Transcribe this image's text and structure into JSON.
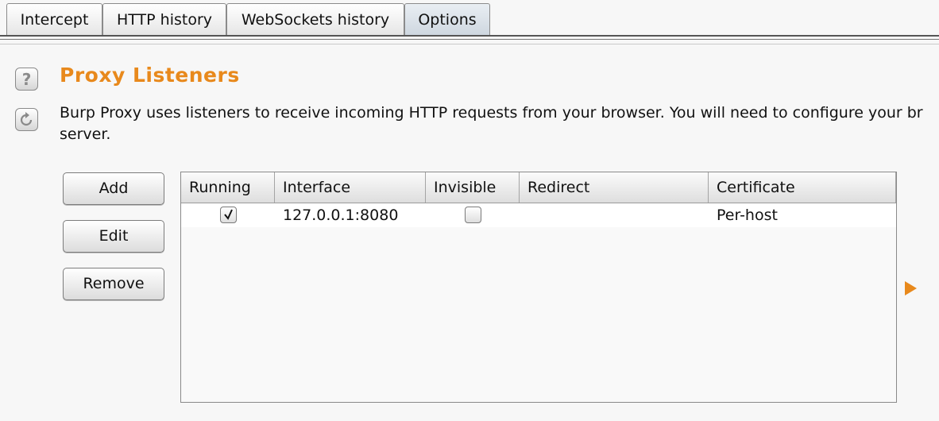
{
  "tabs": [
    {
      "label": "Intercept",
      "active": false
    },
    {
      "label": "HTTP history",
      "active": false
    },
    {
      "label": "WebSockets history",
      "active": false
    },
    {
      "label": "Options",
      "active": true
    }
  ],
  "section": {
    "title": "Proxy Listeners",
    "description_line1": "Burp Proxy uses listeners to receive incoming HTTP requests from your browser. You will need to configure your br",
    "description_line2": "server.",
    "help_icon": "question-mark-icon",
    "restore_icon": "refresh-icon"
  },
  "buttons": {
    "add": "Add",
    "edit": "Edit",
    "remove": "Remove"
  },
  "table": {
    "columns": [
      "Running",
      "Interface",
      "Invisible",
      "Redirect",
      "Certificate"
    ],
    "rows": [
      {
        "running": true,
        "interface": "127.0.0.1:8080",
        "invisible": false,
        "redirect": "",
        "certificate": "Per-host"
      }
    ]
  },
  "colors": {
    "title": "#e8891c",
    "arrow": "#e8891c"
  },
  "side_arrow_icon": "play-arrow-icon"
}
